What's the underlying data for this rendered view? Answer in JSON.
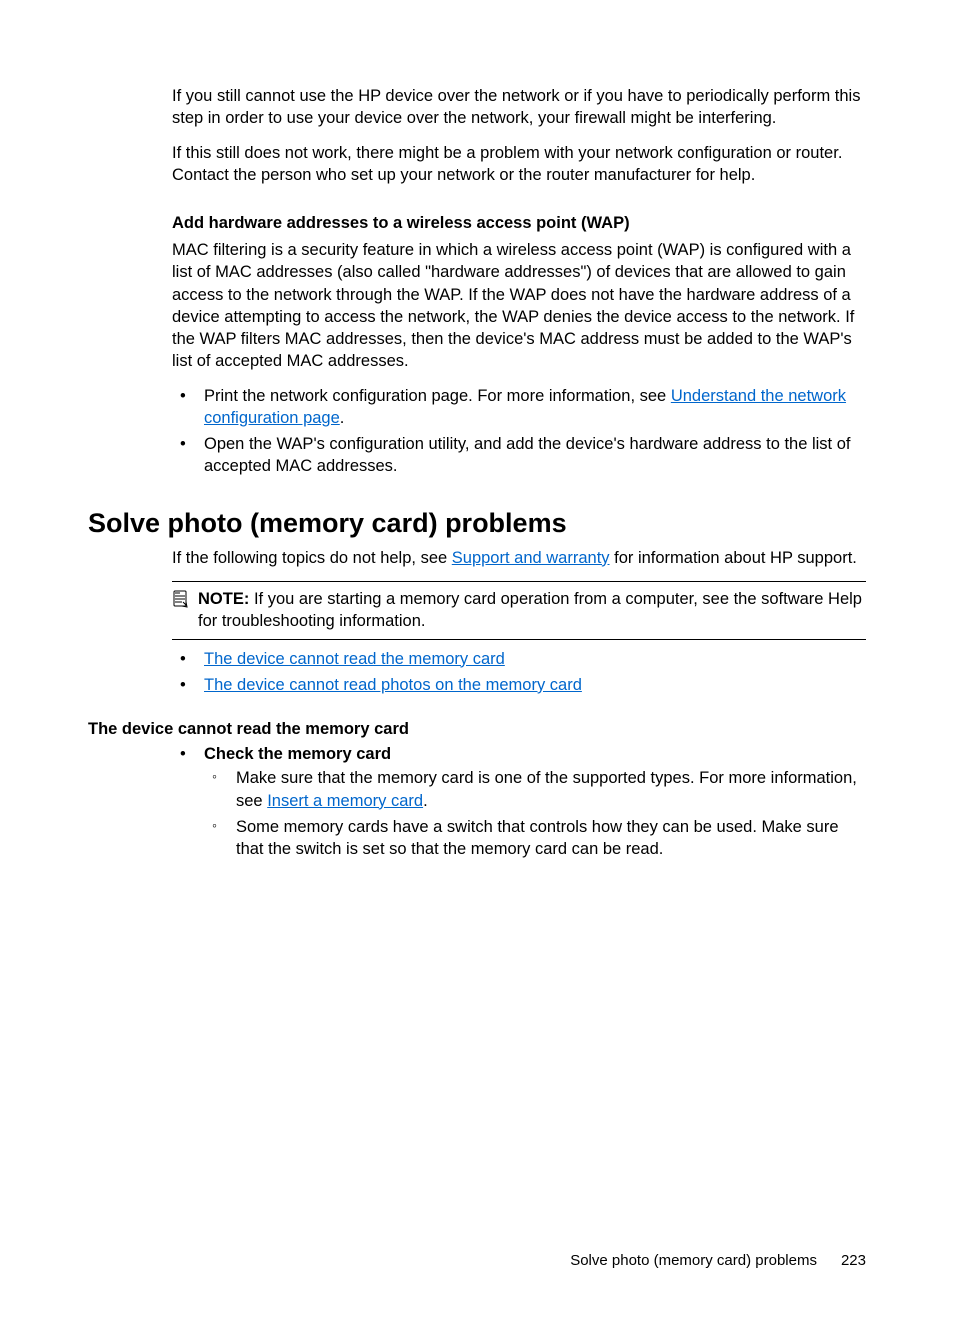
{
  "intro": {
    "p1": "If you still cannot use the HP device over the network or if you have to periodically perform this step in order to use your device over the network, your firewall might be interfering.",
    "p2": "If this still does not work, there might be a problem with your network configuration or router. Contact the person who set up your network or the router manufacturer for help."
  },
  "wap": {
    "heading": "Add hardware addresses to a wireless access point (WAP)",
    "para": "MAC filtering is a security feature in which a wireless access point (WAP) is configured with a list of MAC addresses (also called \"hardware addresses\") of devices that are allowed to gain access to the network through the WAP. If the WAP does not have the hardware address of a device attempting to access the network, the WAP denies the device access to the network. If the WAP filters MAC addresses, then the device's MAC address must be added to the WAP's list of accepted MAC addresses.",
    "b1_pre": "Print the network configuration page. For more information, see ",
    "b1_link": "Understand the network configuration page",
    "b1_post": ".",
    "b2": "Open the WAP's configuration utility, and add the device's hardware address to the list of accepted MAC addresses."
  },
  "photo": {
    "heading": "Solve photo (memory card) problems",
    "intro_pre": "If the following topics do not help, see ",
    "intro_link": "Support and warranty",
    "intro_post": " for information about HP support.",
    "note_label": "NOTE:",
    "note_body": "If you are starting a memory card operation from a computer, see the software Help for troubleshooting information.",
    "link1": "The device cannot read the memory card",
    "link2": "The device cannot read photos on the memory card",
    "sub_heading": "The device cannot read the memory card",
    "chk_heading": "Check the memory card",
    "chk_b1_pre": "Make sure that the memory card is one of the supported types. For more information, see ",
    "chk_b1_link": "Insert a memory card",
    "chk_b1_post": ".",
    "chk_b2": "Some memory cards have a switch that controls how they can be used. Make sure that the switch is set so that the memory card can be read."
  },
  "footer": {
    "section": "Solve photo (memory card) problems",
    "pagenum": "223"
  }
}
